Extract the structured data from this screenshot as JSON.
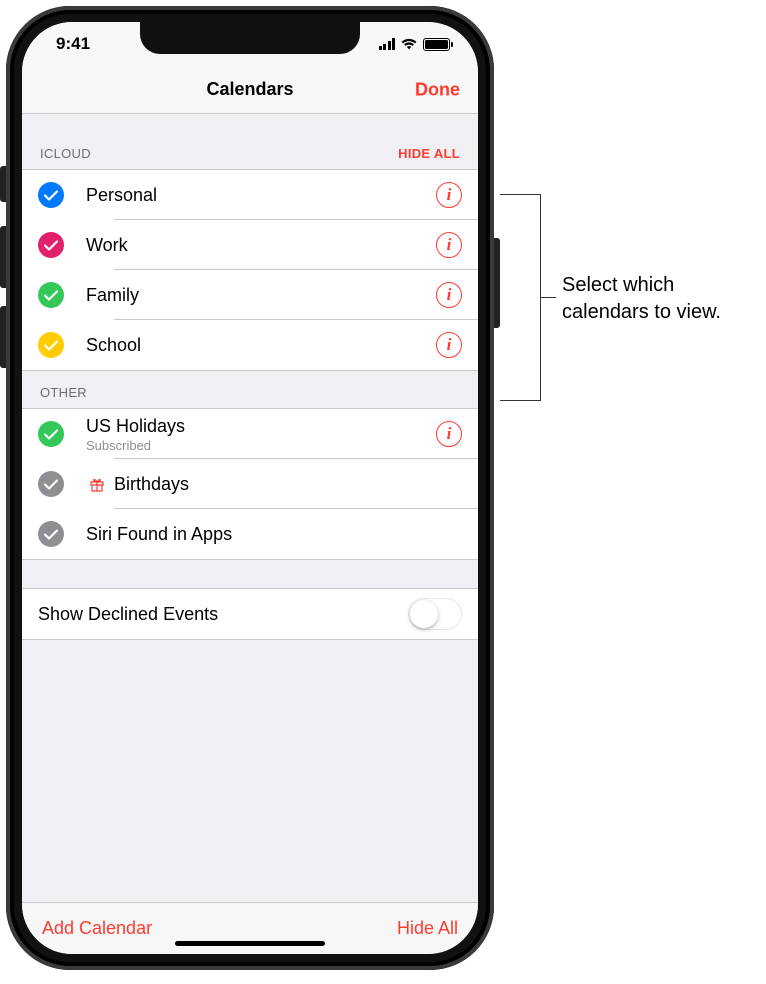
{
  "status": {
    "time": "9:41"
  },
  "nav": {
    "title": "Calendars",
    "done": "Done"
  },
  "sections": {
    "icloud": {
      "header": "ICLOUD",
      "action": "HIDE ALL",
      "items": [
        {
          "label": "Personal",
          "color": "#007aff"
        },
        {
          "label": "Work",
          "color": "#e2206b"
        },
        {
          "label": "Family",
          "color": "#34c759"
        },
        {
          "label": "School",
          "color": "#ffcc00"
        }
      ]
    },
    "other": {
      "header": "OTHER",
      "items": [
        {
          "label": "US Holidays",
          "sub": "Subscribed",
          "color": "#34c759",
          "info": true
        },
        {
          "label": "Birthdays",
          "color": "#8e8e93",
          "gift": true
        },
        {
          "label": "Siri Found in Apps",
          "color": "#8e8e93"
        }
      ]
    }
  },
  "settings": {
    "declined_label": "Show Declined Events",
    "declined_on": false
  },
  "toolbar": {
    "add": "Add Calendar",
    "hide_all": "Hide All"
  },
  "callout": {
    "text": "Select which calendars to view."
  }
}
